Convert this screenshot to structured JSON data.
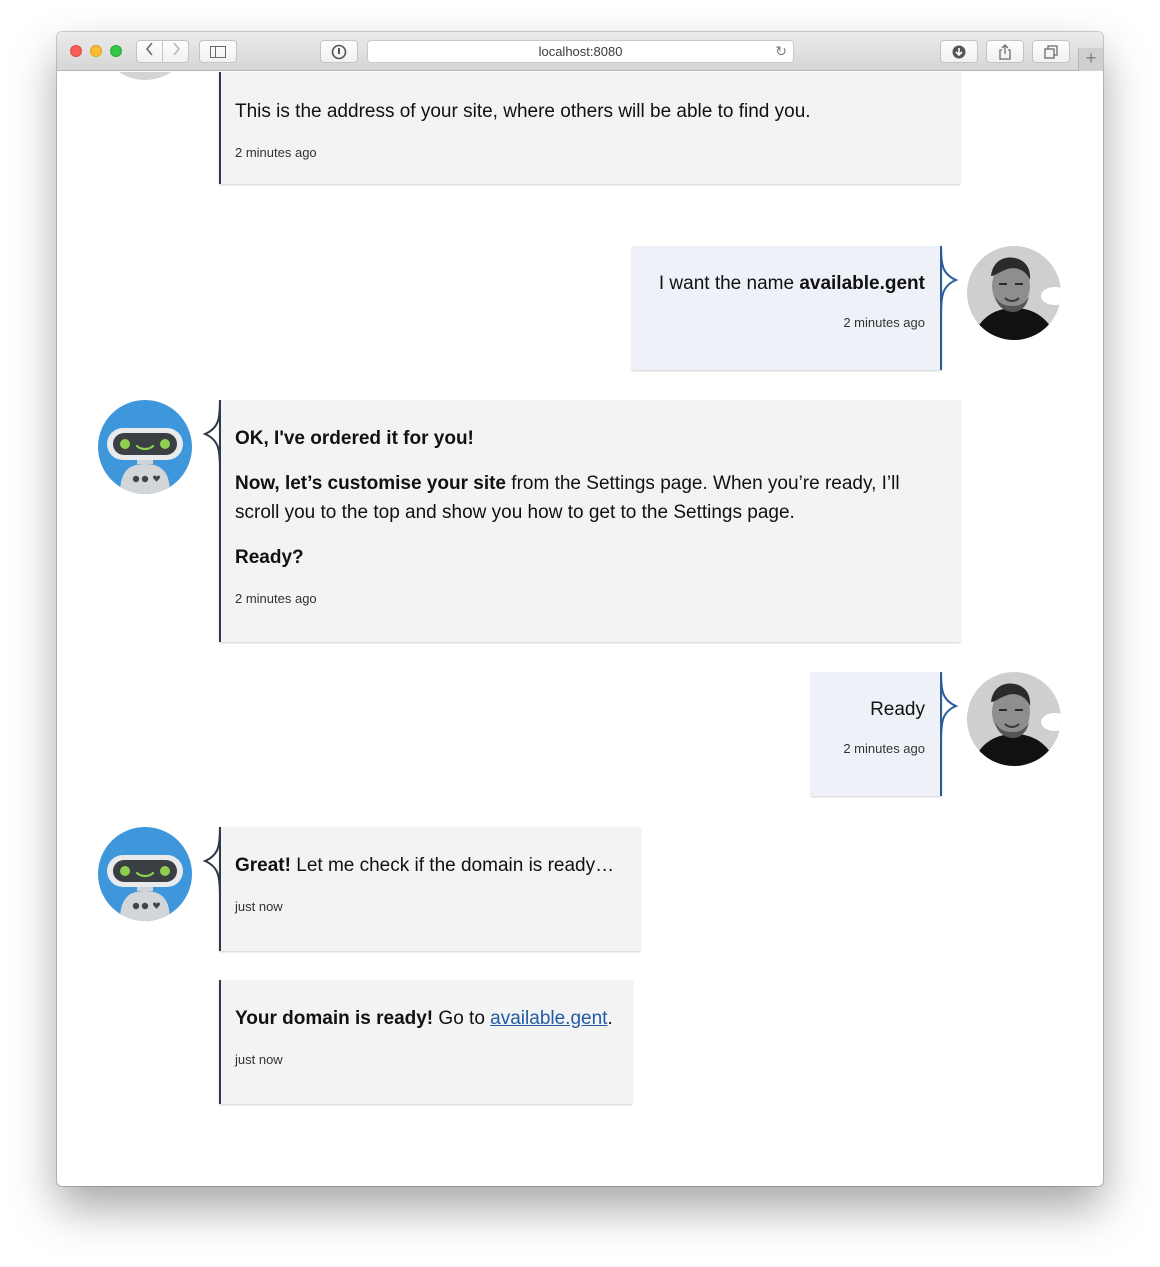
{
  "browser": {
    "url": "localhost:8080",
    "back_icon": "chevron-left-icon",
    "forward_icon": "chevron-right-icon",
    "reload_icon": "reload-icon"
  },
  "colors": {
    "bot_bubble": "#f3f3f3",
    "user_bubble": "#eef2f8",
    "bot_border": "#2d3a4a",
    "user_border": "#2a5d98",
    "bot_avatar": "#3f97db",
    "link": "#1f5ca3"
  },
  "messages": [
    {
      "from": "bot",
      "text": "This is the address of your site, where others will be able to find you.",
      "time": "2 minutes ago"
    },
    {
      "from": "user",
      "text_plain": "I want the name ",
      "text_bold": "available.gent",
      "time": "2 minutes ago"
    },
    {
      "from": "bot",
      "line1_bold": "OK, I've ordered it for you!",
      "line2_bold": "Now, let’s customise your site",
      "line2_rest": " from the Settings page. When you’re ready, I’ll scroll you to the top and show you how to get to the Settings page.",
      "line3_bold": "Ready?",
      "time": "2 minutes ago"
    },
    {
      "from": "user",
      "text": "Ready",
      "time": "2 minutes ago"
    },
    {
      "from": "bot",
      "text_bold": "Great!",
      "text_rest": " Let me check if the domain is ready…",
      "time": "just now"
    },
    {
      "from": "bot",
      "text_bold": "Your domain is ready!",
      "text_pre": " Go to ",
      "link": "available.gent",
      "text_post": ".",
      "time": "just now"
    }
  ]
}
